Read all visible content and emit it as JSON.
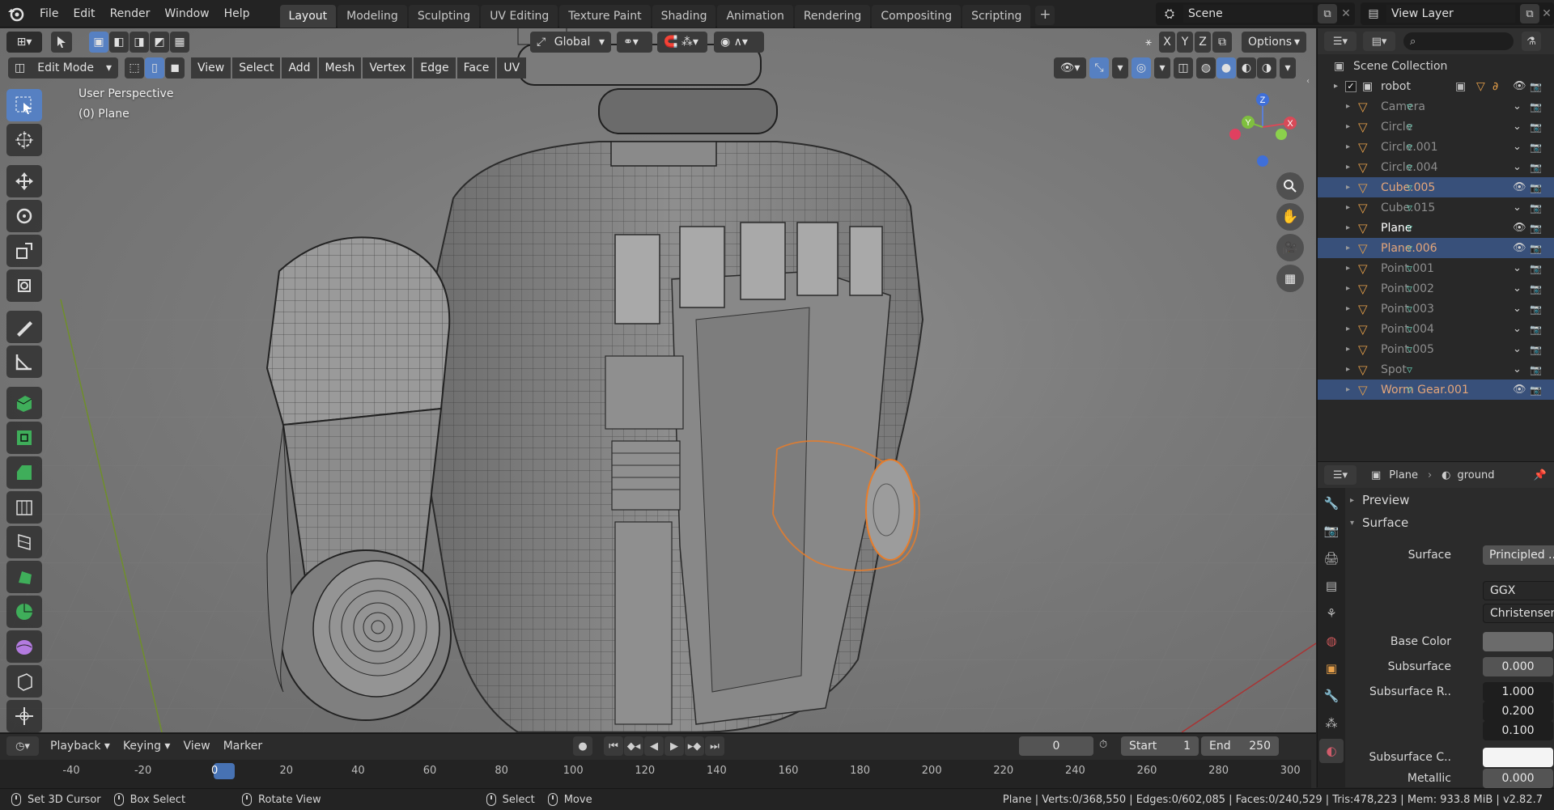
{
  "topbar": {
    "menus": [
      "File",
      "Edit",
      "Render",
      "Window",
      "Help"
    ],
    "workspaces": [
      "Layout",
      "Modeling",
      "Sculpting",
      "UV Editing",
      "Texture Paint",
      "Shading",
      "Animation",
      "Rendering",
      "Compositing",
      "Scripting"
    ],
    "active_workspace": "Layout",
    "scene_name": "Scene",
    "view_layer": "View Layer"
  },
  "viewport": {
    "mode": "Edit Mode",
    "menus": [
      "View",
      "Select",
      "Add",
      "Mesh",
      "Vertex",
      "Edge",
      "Face",
      "UV"
    ],
    "orientation": "Global",
    "axes": [
      "X",
      "Y",
      "Z"
    ],
    "options_label": "Options",
    "perspective_label": "User Perspective",
    "object_label": "(0) Plane",
    "gizmo_axes": {
      "x": "X",
      "y": "Y",
      "z": "Z"
    }
  },
  "outliner": {
    "root": "Scene Collection",
    "collection": "robot",
    "items": [
      {
        "name": "Camera",
        "dim": true
      },
      {
        "name": "Circle",
        "dim": true
      },
      {
        "name": "Circle.001",
        "dim": true
      },
      {
        "name": "Circle.004",
        "dim": true
      },
      {
        "name": "Cube.005",
        "selected": true
      },
      {
        "name": "Cube.015",
        "dim": true
      },
      {
        "name": "Plane",
        "active": true
      },
      {
        "name": "Plane.006",
        "selected": true
      },
      {
        "name": "Point.001",
        "dim": true
      },
      {
        "name": "Point.002",
        "dim": true
      },
      {
        "name": "Point.003",
        "dim": true
      },
      {
        "name": "Point.004",
        "dim": true
      },
      {
        "name": "Point.005",
        "dim": true
      },
      {
        "name": "Spot",
        "dim": true
      },
      {
        "name": "Worm Gear.001",
        "selected": true
      }
    ]
  },
  "properties": {
    "object": "Plane",
    "material": "ground",
    "panels": {
      "preview": "Preview",
      "surface": "Surface"
    },
    "surface_label": "Surface",
    "surface_value": "Principled ..",
    "distribution": "GGX",
    "subsurface_method": "Christensen-...",
    "base_color_label": "Base Color",
    "subsurface_label": "Subsurface",
    "subsurface_value": "0.000",
    "subsurface_radius_label": "Subsurface R..",
    "subsurface_radius": [
      "1.000",
      "0.200",
      "0.100"
    ],
    "subsurface_color_label": "Subsurface C..",
    "metallic_label": "Metallic",
    "metallic_value": "0.000"
  },
  "timeline": {
    "menus": [
      "Playback",
      "Keying",
      "View",
      "Marker"
    ],
    "current_frame": "0",
    "start_label": "Start",
    "start_value": "1",
    "end_label": "End",
    "end_value": "250",
    "ticks": [
      "-40",
      "-20",
      "0",
      "20",
      "40",
      "60",
      "80",
      "100",
      "120",
      "140",
      "160",
      "180",
      "200",
      "220",
      "240",
      "260",
      "280",
      "300"
    ]
  },
  "statusbar": {
    "set_cursor": "Set 3D Cursor",
    "box_select": "Box Select",
    "rotate_view": "Rotate View",
    "select": "Select",
    "move": "Move",
    "stats": "Plane | Verts:0/368,550 | Edges:0/602,085 | Faces:0/240,529 | Tris:478,223 | Mem: 933.8 MiB | v2.82.7"
  },
  "colors": {
    "accent": "#5680c2",
    "selection_orange": "#e87d2a",
    "outliner_selected": "#38507a"
  }
}
